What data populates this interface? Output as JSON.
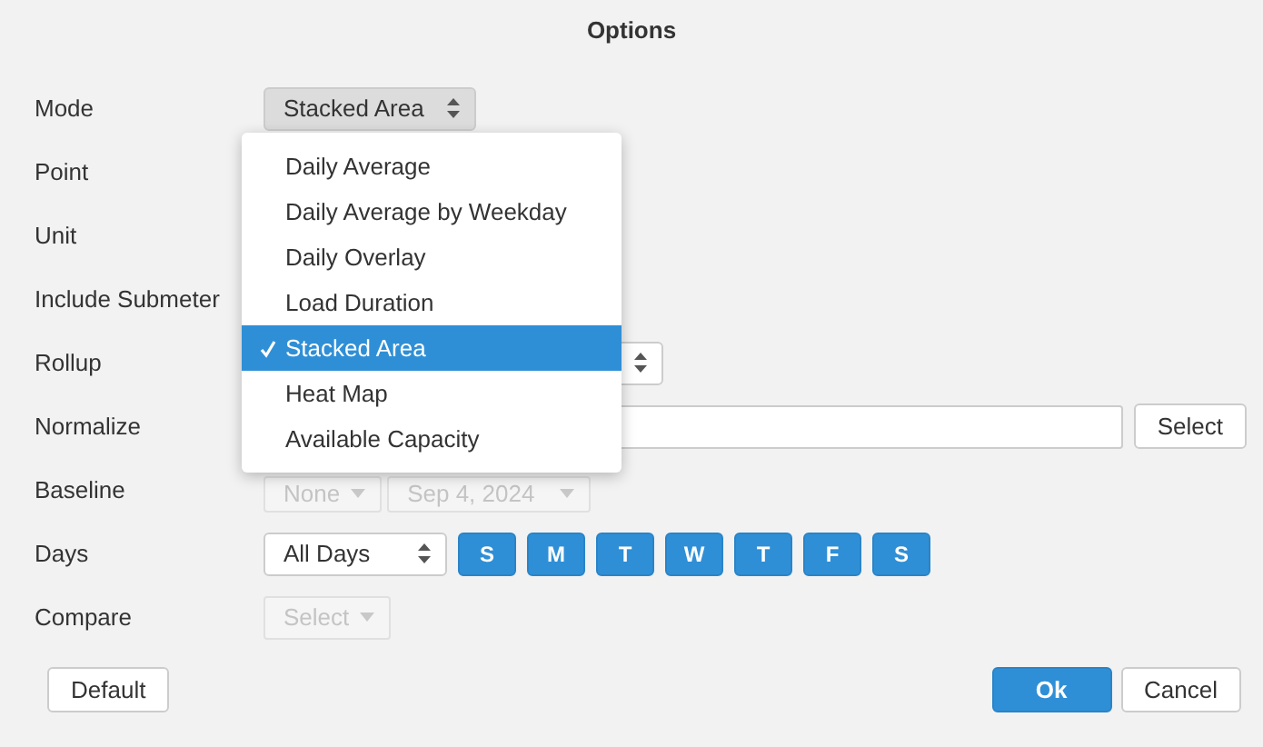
{
  "window": {
    "title": "Options"
  },
  "rows": [
    {
      "label": "Mode",
      "kind": "mode"
    },
    {
      "label": "Point",
      "kind": "none"
    },
    {
      "label": "Unit",
      "kind": "none"
    },
    {
      "label": "Include Submeter",
      "kind": "none"
    },
    {
      "label": "Rollup",
      "kind": "rollup"
    },
    {
      "label": "Normalize",
      "kind": "normalize"
    },
    {
      "label": "Baseline",
      "kind": "baseline"
    },
    {
      "label": "Days",
      "kind": "days"
    },
    {
      "label": "Compare",
      "kind": "compare"
    }
  ],
  "mode_select": {
    "value": "Stacked Area"
  },
  "mode_menu": [
    {
      "label": "Daily Average",
      "selected": false
    },
    {
      "label": "Daily Average by Weekday",
      "selected": false
    },
    {
      "label": "Daily Overlay",
      "selected": false
    },
    {
      "label": "Load Duration",
      "selected": false
    },
    {
      "label": "Stacked Area",
      "selected": true
    },
    {
      "label": "Heat Map",
      "selected": false
    },
    {
      "label": "Available Capacity",
      "selected": false
    }
  ],
  "normalize_button": "Select",
  "baseline": {
    "disabled": true,
    "selects": [
      "None",
      "Sep 4, 2024"
    ]
  },
  "days": {
    "value": "All Days",
    "weekdays": [
      {
        "label": "S",
        "selected": true
      },
      {
        "label": "M",
        "selected": true
      },
      {
        "label": "T",
        "selected": true
      },
      {
        "label": "W",
        "selected": true
      },
      {
        "label": "T",
        "selected": true
      },
      {
        "label": "F",
        "selected": true
      },
      {
        "label": "S",
        "selected": true
      }
    ]
  },
  "compare": {
    "value": "Select",
    "disabled": true
  },
  "buttons": {
    "default": "Default",
    "ok": "Ok",
    "cancel": "Cancel"
  }
}
